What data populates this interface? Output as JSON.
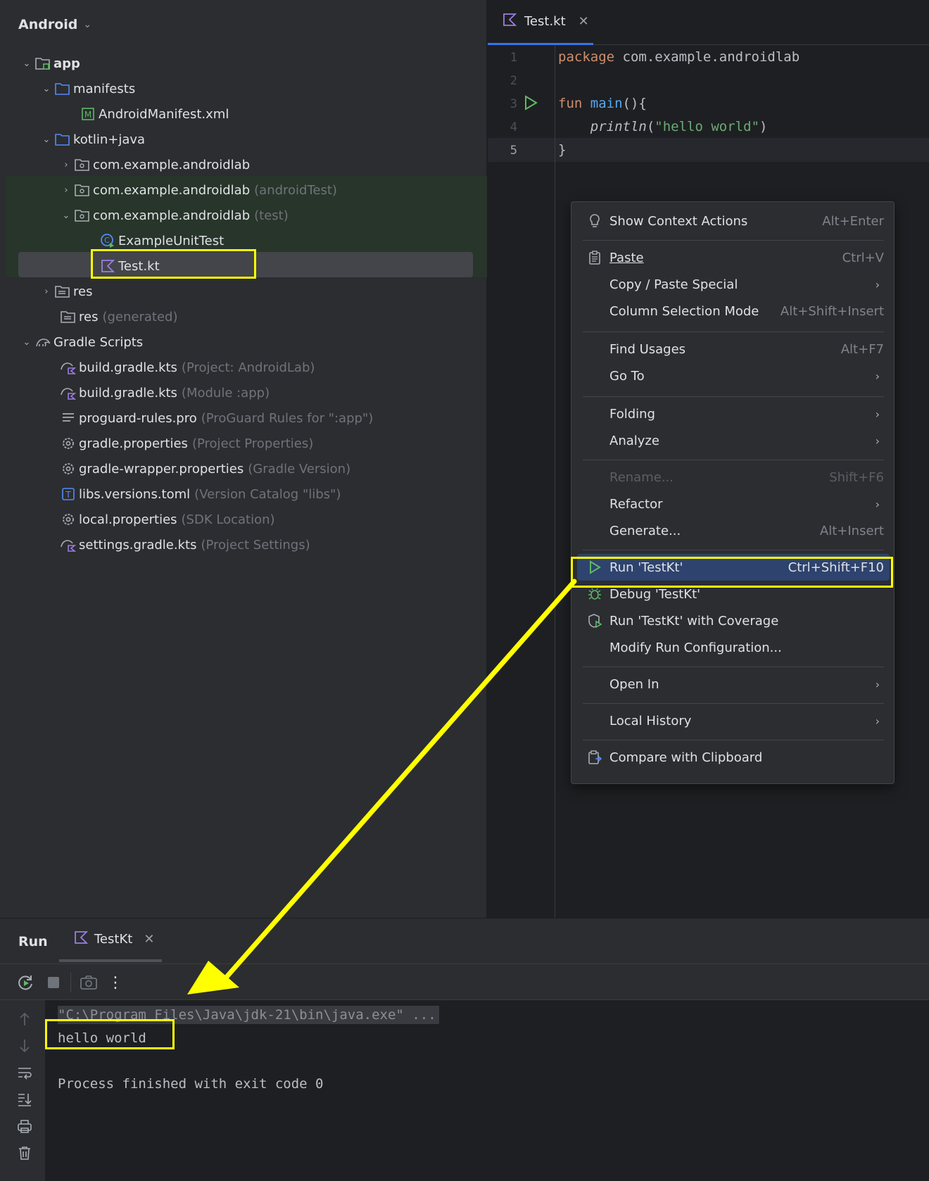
{
  "project": {
    "view_label": "Android",
    "tree": [
      {
        "id": "app",
        "label": "app",
        "hint": ""
      },
      {
        "id": "manifests",
        "label": "manifests",
        "hint": ""
      },
      {
        "id": "manifest-file",
        "label": "AndroidManifest.xml",
        "hint": ""
      },
      {
        "id": "kotlin-java",
        "label": "kotlin+java",
        "hint": ""
      },
      {
        "id": "pkg-main",
        "label": "com.example.androidlab",
        "hint": ""
      },
      {
        "id": "pkg-androidtest",
        "label": "com.example.androidlab",
        "hint": "(androidTest)"
      },
      {
        "id": "pkg-test",
        "label": "com.example.androidlab",
        "hint": "(test)"
      },
      {
        "id": "example-unit-test",
        "label": "ExampleUnitTest",
        "hint": ""
      },
      {
        "id": "test-kt",
        "label": "Test.kt",
        "hint": ""
      },
      {
        "id": "res",
        "label": "res",
        "hint": ""
      },
      {
        "id": "res-generated",
        "label": "res",
        "hint": "(generated)"
      },
      {
        "id": "gradle-scripts",
        "label": "Gradle Scripts",
        "hint": ""
      },
      {
        "id": "build-gradle-project",
        "label": "build.gradle.kts",
        "hint": "(Project: AndroidLab)"
      },
      {
        "id": "build-gradle-module",
        "label": "build.gradle.kts",
        "hint": "(Module :app)"
      },
      {
        "id": "proguard",
        "label": "proguard-rules.pro",
        "hint": "(ProGuard Rules for \":app\")"
      },
      {
        "id": "gradle-properties",
        "label": "gradle.properties",
        "hint": "(Project Properties)"
      },
      {
        "id": "gradle-wrapper",
        "label": "gradle-wrapper.properties",
        "hint": "(Gradle Version)"
      },
      {
        "id": "libs-versions",
        "label": "libs.versions.toml",
        "hint": "(Version Catalog \"libs\")"
      },
      {
        "id": "local-properties",
        "label": "local.properties",
        "hint": "(SDK Location)"
      },
      {
        "id": "settings-gradle",
        "label": "settings.gradle.kts",
        "hint": "(Project Settings)"
      }
    ]
  },
  "editor": {
    "tab_label": "Test.kt",
    "line_numbers": [
      "1",
      "2",
      "3",
      "4",
      "5"
    ],
    "code": {
      "l1_kw": "package",
      "l1_rest": " com.example.androidlab",
      "l3_kw": "fun",
      "l3_fn": "main",
      "l3_rest": "(){",
      "l4_call": "println",
      "l4_open": "(",
      "l4_str": "\"hello world\"",
      "l4_close": ")",
      "l5": "}"
    }
  },
  "context_menu": {
    "show_context_actions": {
      "label": "Show Context Actions",
      "shortcut": "Alt+Enter"
    },
    "paste": {
      "label": "Paste",
      "shortcut": "Ctrl+V"
    },
    "copy_paste_special": {
      "label": "Copy / Paste Special"
    },
    "column_selection": {
      "label": "Column Selection Mode",
      "shortcut": "Alt+Shift+Insert"
    },
    "find_usages": {
      "label": "Find Usages",
      "shortcut": "Alt+F7"
    },
    "go_to": {
      "label": "Go To"
    },
    "folding": {
      "label": "Folding"
    },
    "analyze": {
      "label": "Analyze"
    },
    "rename": {
      "label": "Rename...",
      "shortcut": "Shift+F6"
    },
    "refactor": {
      "label": "Refactor"
    },
    "generate": {
      "label": "Generate...",
      "shortcut": "Alt+Insert"
    },
    "run": {
      "label": "Run 'TestKt'",
      "shortcut": "Ctrl+Shift+F10"
    },
    "debug": {
      "label": "Debug 'TestKt'"
    },
    "run_coverage": {
      "label": "Run 'TestKt' with Coverage"
    },
    "modify_run_config": {
      "label": "Modify Run Configuration..."
    },
    "open_in": {
      "label": "Open In"
    },
    "local_history": {
      "label": "Local History"
    },
    "compare_clipboard": {
      "label": "Compare with Clipboard"
    }
  },
  "run_window": {
    "title": "Run",
    "tab_label": "TestKt",
    "console": {
      "command": "\"C:\\Program Files\\Java\\jdk-21\\bin\\java.exe\" ...",
      "output": "hello world",
      "exit_message": "Process finished with exit code 0"
    }
  },
  "colors": {
    "highlight": "#ffff00",
    "accent": "#3574f0",
    "menu_active": "#2e436e",
    "run_green": "#5fb865"
  }
}
